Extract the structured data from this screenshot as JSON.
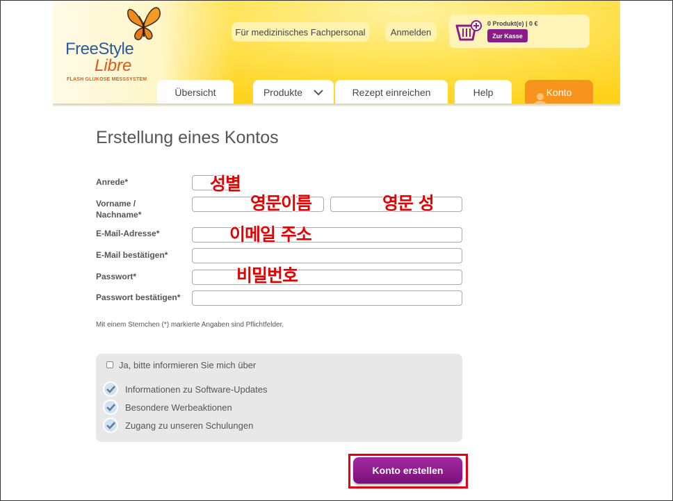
{
  "header": {
    "logo_freestyle": "FreeStyle",
    "logo_libre": "Libre",
    "logo_sub": "FLASH GLUKOSE MESSSYSTEM",
    "professional_label": "Für medizinisches Fachpersonal",
    "login_label": "Anmelden",
    "cart_summary": "0 Produkt(e) | 0 €",
    "checkout_label": "Zur Kasse"
  },
  "nav": {
    "tabs": [
      {
        "label": "Übersicht"
      },
      {
        "label": "Produkte"
      },
      {
        "label": "Rezept einreichen"
      },
      {
        "label": "Help"
      },
      {
        "label": "Konto"
      }
    ]
  },
  "form": {
    "title": "Erstellung eines Kontos",
    "salutation_label": "Anrede*",
    "name_label_line1": "Vorname /",
    "name_label_line2": "Nachname*",
    "email_label": "E-Mail-Adresse*",
    "email_confirm_label": "E-Mail bestätigen*",
    "password_label": "Passwort*",
    "password_confirm_label": "Passwort bestätigen*",
    "required_note": "Mit einem Sternchen (*) markierte Angaben sind Pflichtfelder.",
    "submit_label": "Konto erstellen"
  },
  "newsletter": {
    "checkbox_label": "Ja, bitte informieren Sie mich über",
    "items": [
      "Informationen zu Software-Updates",
      "Besondere Werbeaktionen",
      "Zugang zu unseren Schulungen"
    ]
  },
  "annotations": {
    "salutation": "성별",
    "first_name": "영문이름",
    "last_name": "영문 성",
    "email": "이메일 주소",
    "password": "비밀번호"
  },
  "colors": {
    "accent_purple": "#8b1a8a",
    "konto_orange": "#f7941d",
    "header_yellow": "#ffd21a",
    "annotation_red": "#e60000"
  }
}
